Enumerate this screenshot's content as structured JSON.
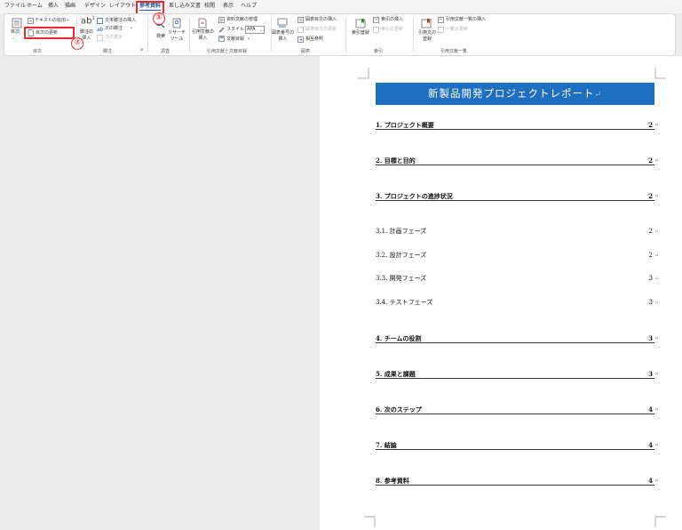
{
  "tabs": [
    "ファイル",
    "ホーム",
    "挿入",
    "描画",
    "デザイン",
    "レイアウト",
    "参考資料",
    "差し込み文書",
    "校閲",
    "表示",
    "ヘルプ"
  ],
  "ribbon": {
    "toc_button": "目次",
    "add_text": "テキストの追加",
    "update_toc": "目次の更新",
    "insert_footnote": "脚注の\n挿入",
    "insert_endnote": "文末脚注の挿入",
    "next_footnote": "次の脚注",
    "show_notes": "注の表示",
    "search": "検索",
    "researcher": "リサーチ\nツール",
    "insert_citation": "引用文献の\n挿入",
    "manage_sources": "資料文献の管理",
    "style_label": "スタイル:",
    "style_value": "APA",
    "bibliography": "文献目録",
    "insert_caption": "図表番号の\n挿入",
    "insert_table_of_figures": "図表目次の挿入",
    "update_table": "図表目次の更新",
    "cross_reference": "相互参照",
    "mark_entry": "索引登録",
    "insert_index": "索引の挿入",
    "update_index": "索引の更新",
    "mark_citation": "引用文の\n登録",
    "insert_toa": "引用文献一覧の挿入",
    "update_toa": "一覧の更新",
    "groups": [
      "目次",
      "脚注",
      "調査",
      "引用文献と文献目録",
      "図表",
      "索引",
      "引用文献一覧"
    ]
  },
  "annotations": {
    "step1": "①",
    "step2": "②"
  },
  "document": {
    "title": "新製品開発プロジェクトレポート",
    "para_mark": "↵",
    "toc": [
      {
        "title": "1.  プロジェクト概要",
        "page": "2",
        "level": 1
      },
      {
        "title": "2.  目標と目的",
        "page": "2",
        "level": 1
      },
      {
        "title": "3.  プロジェクトの進捗状況",
        "page": "2",
        "level": 1
      },
      {
        "title": "3.1.  計画フェーズ",
        "page": "2",
        "level": 2
      },
      {
        "title": "3.2.  設計フェーズ",
        "page": "2",
        "level": 2
      },
      {
        "title": "3.3.  開発フェーズ",
        "page": "3",
        "level": 2
      },
      {
        "title": "3.4.  テストフェーズ",
        "page": "3",
        "level": 2
      },
      {
        "title": "4.  チームの役割",
        "page": "3",
        "level": 1
      },
      {
        "title": "5.  成果と課題",
        "page": "3",
        "level": 1
      },
      {
        "title": "6.  次のステップ",
        "page": "4",
        "level": 1
      },
      {
        "title": "7.  結論",
        "page": "4",
        "level": 1
      },
      {
        "title": "8.  参考資料",
        "page": "4",
        "level": 1
      }
    ]
  }
}
